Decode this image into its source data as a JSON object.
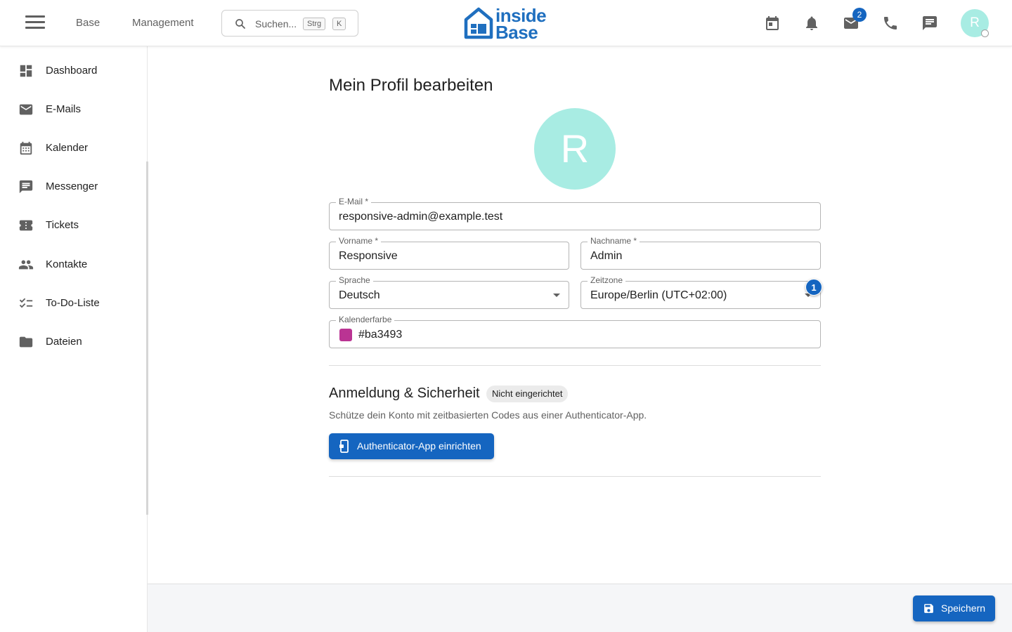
{
  "header": {
    "nav": [
      "Base",
      "Management"
    ],
    "search": {
      "placeholder": "Suchen...",
      "kbd1": "Strg",
      "kbd2": "K"
    },
    "logo": {
      "line1": "inside",
      "line2": "Base"
    },
    "icons": [
      "calendar-icon",
      "bell-icon",
      "mail-icon",
      "phone-icon",
      "chat-icon"
    ],
    "mail_badge": "2",
    "avatar_initial": "R"
  },
  "sidebar": {
    "items": [
      {
        "label": "Dashboard",
        "icon": "dashboard-icon"
      },
      {
        "label": "E-Mails",
        "icon": "mail-icon"
      },
      {
        "label": "Kalender",
        "icon": "calendar-icon"
      },
      {
        "label": "Messenger",
        "icon": "chat-icon"
      },
      {
        "label": "Tickets",
        "icon": "ticket-icon"
      },
      {
        "label": "Kontakte",
        "icon": "people-icon"
      },
      {
        "label": "To-Do-Liste",
        "icon": "checklist-icon"
      },
      {
        "label": "Dateien",
        "icon": "folder-icon"
      }
    ]
  },
  "main": {
    "title": "Mein Profil bearbeiten",
    "avatar_initial": "R",
    "fields": {
      "email": {
        "label": "E-Mail *",
        "value": "responsive-admin@example.test"
      },
      "firstname": {
        "label": "Vorname *",
        "value": "Responsive"
      },
      "lastname": {
        "label": "Nachname *",
        "value": "Admin"
      },
      "language": {
        "label": "Sprache",
        "value": "Deutsch"
      },
      "timezone": {
        "label": "Zeitzone",
        "value": "Europe/Berlin (UTC+02:00)",
        "badge": "1"
      },
      "calendar_color": {
        "label": "Kalenderfarbe",
        "value": "#ba3493"
      }
    },
    "security": {
      "title": "Anmeldung & Sicherheit",
      "chip": "Nicht eingerichtet",
      "description": "Schütze dein Konto mit zeitbasierten Codes aus einer Authenticator-App.",
      "button": "Authenticator-App einrichten"
    }
  },
  "footer": {
    "save_label": "Speichern"
  },
  "colors": {
    "primary": "#1565c0",
    "avatar": "#a8ece3",
    "calendar": "#ba3493"
  }
}
